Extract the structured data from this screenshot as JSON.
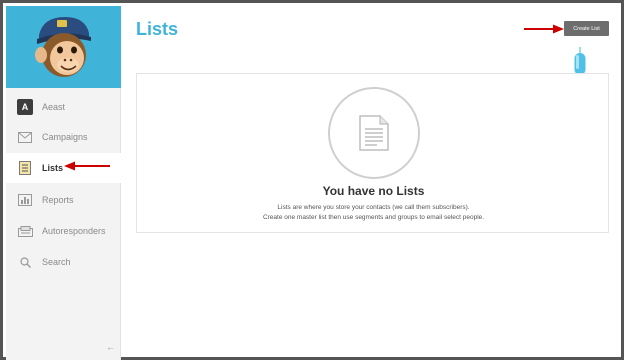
{
  "account": {
    "initial": "A",
    "name": "Aeast"
  },
  "nav": {
    "campaigns": "Campaigns",
    "lists": "Lists",
    "reports": "Reports",
    "autoresponders": "Autoresponders",
    "search": "Search",
    "collapse": "←"
  },
  "header": {
    "title": "Lists",
    "create_button": "Create List"
  },
  "empty_state": {
    "title": "You have no Lists",
    "line1": "Lists are where you store your contacts (we call them subscribers).",
    "line2": "Create one master list then use segments and groups to email select people."
  },
  "colors": {
    "accent": "#3fb4d8",
    "annotation_arrow": "#cc0000",
    "button": "#6d6d6d"
  },
  "icons": [
    "chimp-logo-icon",
    "envelope-icon",
    "list-icon",
    "bar-chart-icon",
    "autoresponder-icon",
    "search-icon",
    "document-icon",
    "arrow-left-icon"
  ]
}
